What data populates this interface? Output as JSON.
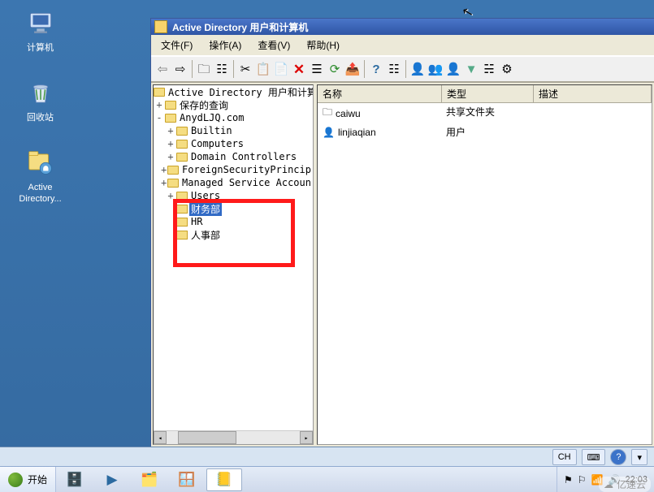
{
  "desktop_icons": [
    {
      "name": "computer",
      "label": "计算机"
    },
    {
      "name": "recycle",
      "label": "回收站"
    },
    {
      "name": "aduc",
      "label": "Active\nDirectory..."
    }
  ],
  "window": {
    "title": "Active Directory 用户和计算机",
    "menu": [
      "文件(F)",
      "操作(A)",
      "查看(V)",
      "帮助(H)"
    ],
    "toolbar_names": [
      "back",
      "forward",
      "up",
      "show-hide",
      "cut",
      "copy",
      "paste",
      "delete",
      "properties",
      "refresh",
      "export",
      "help",
      "filter",
      "users1",
      "users2",
      "users3",
      "funnel",
      "opt",
      "opt2"
    ]
  },
  "tree": {
    "root": "Active Directory 用户和计算机",
    "saved": "保存的查询",
    "domain": "AnydLJQ.com",
    "children": [
      "Builtin",
      "Computers",
      "Domain Controllers",
      "ForeignSecurityPrincip",
      "Managed Service Accoun",
      "Users"
    ],
    "ous": [
      "财务部",
      "HR",
      "人事部"
    ],
    "selected": "财务部"
  },
  "list": {
    "headers": [
      "名称",
      "类型",
      "描述"
    ],
    "rows": [
      {
        "name": "caiwu",
        "type": "共享文件夹",
        "desc": "",
        "icon": "share"
      },
      {
        "name": "linjiaqian",
        "type": "用户",
        "desc": "",
        "icon": "user"
      }
    ]
  },
  "tray": {
    "lang": "CH"
  },
  "taskbar": {
    "start": "开始",
    "clock": "22:03"
  },
  "watermark": "亿速云"
}
